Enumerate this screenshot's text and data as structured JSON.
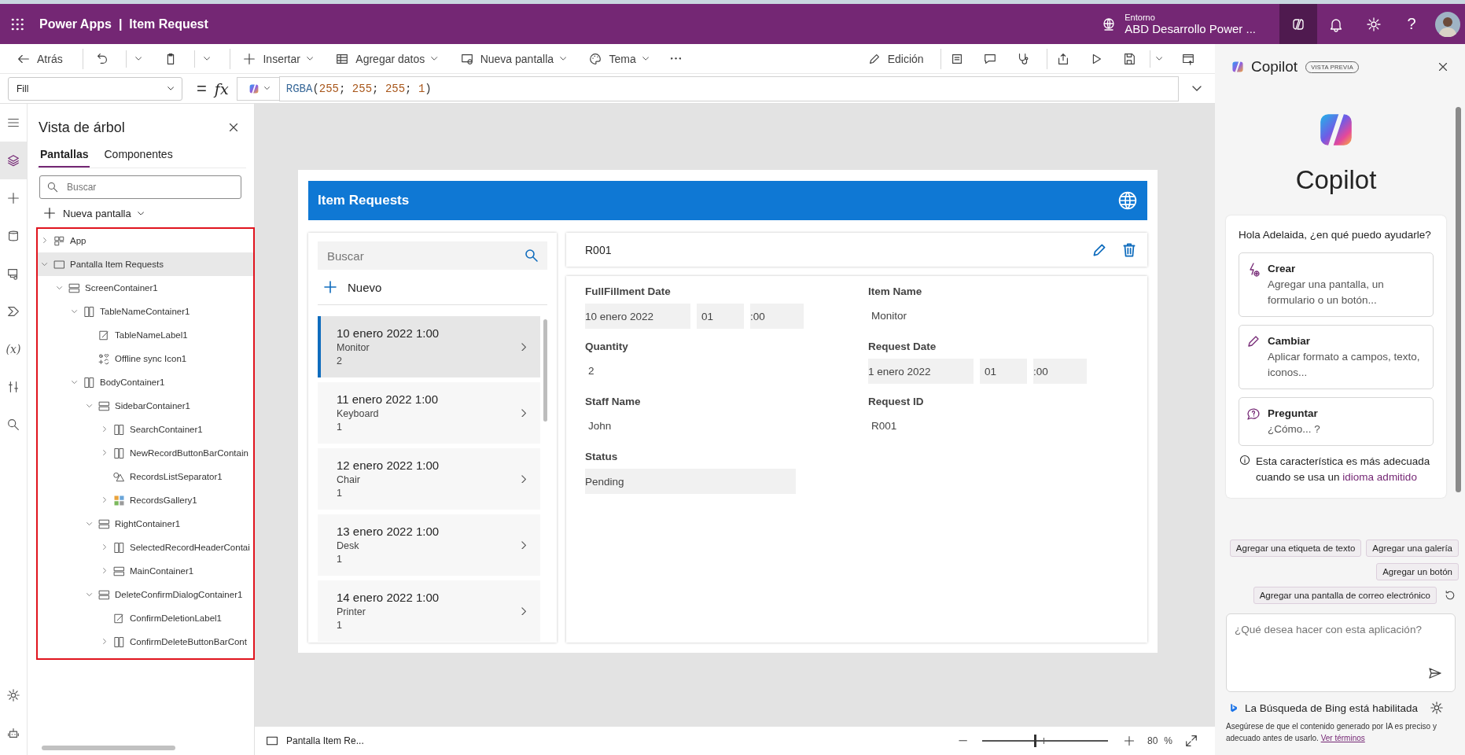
{
  "top_bar": {
    "product": "Power Apps",
    "divider": "|",
    "app_name": "Item Request",
    "environment_label": "Entorno",
    "environment_name": "ABD Desarrollo Power ...",
    "copilot_on": true,
    "help": "?"
  },
  "toolbar": {
    "back": "Atrás",
    "menus": [
      {
        "kind": "insert",
        "label": "Insertar"
      },
      {
        "kind": "data",
        "label": "Agregar datos"
      },
      {
        "kind": "screen",
        "label": "Nueva pantalla"
      },
      {
        "kind": "theme",
        "label": "Tema"
      }
    ],
    "edit": "Edición"
  },
  "formula_bar": {
    "property": "Fill",
    "equals": "=",
    "fx": "fx",
    "formula": [
      {
        "text": "RGBA",
        "kind": "function"
      },
      {
        "text": "(",
        "kind": "punct"
      },
      {
        "text": "255",
        "kind": "number"
      },
      {
        "text": "; ",
        "kind": "punct"
      },
      {
        "text": "255",
        "kind": "number"
      },
      {
        "text": "; ",
        "kind": "punct"
      },
      {
        "text": "255",
        "kind": "number"
      },
      {
        "text": "; ",
        "kind": "punct"
      },
      {
        "text": "1",
        "kind": "number"
      },
      {
        "text": ")",
        "kind": "punct"
      }
    ]
  },
  "rail": [
    {
      "kind": "menu",
      "selected": false
    },
    {
      "kind": "tree",
      "selected": true
    },
    {
      "kind": "insert",
      "selected": false
    },
    {
      "kind": "data",
      "selected": false
    },
    {
      "kind": "media",
      "selected": false
    },
    {
      "kind": "flow",
      "selected": false
    },
    {
      "kind": "variables",
      "glyph": "(x)",
      "selected": false
    },
    {
      "kind": "tools",
      "selected": false
    },
    {
      "kind": "search",
      "selected": false
    }
  ],
  "rail_bottom": [
    {
      "kind": "settings"
    },
    {
      "kind": "bot"
    }
  ],
  "tree_view": {
    "title": "Vista de árbol",
    "tabs": [
      {
        "label": "Pantallas",
        "selected": true
      },
      {
        "label": "Componentes",
        "selected": false
      }
    ],
    "search_placeholder": "Buscar",
    "new_screen": "Nueva pantalla",
    "items": [
      {
        "label": "App",
        "kind": "app",
        "expanded": false,
        "selected": false
      },
      {
        "label": "Pantalla Item Requests",
        "kind": "screen",
        "expanded": true,
        "selected": true,
        "children": [
          {
            "label": "ScreenContainer1",
            "kind": "rows",
            "expanded": true,
            "selected": false,
            "children": [
              {
                "label": "TableNameContainer1",
                "kind": "cols",
                "expanded": true,
                "selected": false,
                "children": [
                  {
                    "label": "TableNameLabel1",
                    "kind": "label",
                    "selected": false
                  },
                  {
                    "label": "Offline sync Icon1",
                    "kind": "icons",
                    "selected": false
                  }
                ]
              },
              {
                "label": "BodyContainer1",
                "kind": "cols",
                "expanded": true,
                "selected": false,
                "children": [
                  {
                    "label": "SidebarContainer1",
                    "kind": "rows",
                    "expanded": true,
                    "selected": false,
                    "children": [
                      {
                        "label": "SearchContainer1",
                        "kind": "cols",
                        "expanded": false,
                        "selected": false
                      },
                      {
                        "label": "NewRecordButtonBarContain",
                        "kind": "cols",
                        "expanded": false,
                        "selected": false
                      },
                      {
                        "label": "RecordsListSeparator1",
                        "kind": "shapes",
                        "selected": false
                      },
                      {
                        "label": "RecordsGallery1",
                        "kind": "gallery",
                        "expanded": false,
                        "selected": false
                      }
                    ]
                  },
                  {
                    "label": "RightContainer1",
                    "kind": "rows",
                    "expanded": true,
                    "selected": false,
                    "children": [
                      {
                        "label": "SelectedRecordHeaderContai",
                        "kind": "cols",
                        "expanded": false,
                        "selected": false
                      },
                      {
                        "label": "MainContainer1",
                        "kind": "rows",
                        "expanded": false,
                        "selected": false
                      }
                    ]
                  },
                  {
                    "label": "DeleteConfirmDialogContainer1",
                    "kind": "rows",
                    "expanded": true,
                    "selected": false,
                    "children": [
                      {
                        "label": "ConfirmDeletionLabel1",
                        "kind": "label",
                        "selected": false
                      },
                      {
                        "label": "ConfirmDeleteButtonBarCont",
                        "kind": "cols",
                        "expanded": false,
                        "selected": false
                      }
                    ]
                  }
                ]
              }
            ]
          }
        ]
      }
    ]
  },
  "app_preview": {
    "title": "Item Requests",
    "search_placeholder": "Buscar",
    "new_button": "Nuevo",
    "gallery": [
      {
        "date": "10 enero 2022 1:00",
        "item": "Monitor",
        "quantity": "2",
        "selected": true
      },
      {
        "date": "11 enero 2022 1:00",
        "item": "Keyboard",
        "quantity": "1",
        "selected": false
      },
      {
        "date": "12 enero 2022 1:00",
        "item": "Chair",
        "quantity": "1",
        "selected": false
      },
      {
        "date": "13 enero 2022 1:00",
        "item": "Desk",
        "quantity": "1",
        "selected": false
      },
      {
        "date": "14 enero 2022 1:00",
        "item": "Printer",
        "quantity": "1",
        "selected": false
      }
    ],
    "record_title": "R001",
    "fields": [
      {
        "label": "FullFillment Date",
        "kind": "datetime",
        "date": "10 enero 2022",
        "hour": "01",
        "minute": ":00"
      },
      {
        "label": "Item Name",
        "kind": "text",
        "value": "Monitor"
      },
      {
        "label": "Quantity",
        "kind": "text",
        "value": "2"
      },
      {
        "label": "Request Date",
        "kind": "datetime",
        "date": "1 enero 2022",
        "hour": "01",
        "minute": ":00"
      },
      {
        "label": "Staff Name",
        "kind": "text",
        "value": "John"
      },
      {
        "label": "Request ID",
        "kind": "text",
        "value": "R001"
      },
      {
        "label": "Status",
        "kind": "choice",
        "value": "Pending"
      }
    ]
  },
  "copilot": {
    "title": "Copilot",
    "badge": "VISTA PREVIA",
    "hero_title": "Copilot",
    "greeting": "Hola Adelaida, ¿en qué puedo ayudarle?",
    "options": [
      {
        "kind": "create",
        "title": "Crear",
        "description": "Agregar una pantalla, un formulario o un botón..."
      },
      {
        "kind": "change",
        "title": "Cambiar",
        "description": "Aplicar formato a campos, texto, iconos..."
      },
      {
        "kind": "ask",
        "title": "Preguntar",
        "description": "¿Cómo... ?"
      }
    ],
    "info_text": "Esta característica es más adecuada cuando se usa un",
    "info_link": "idioma admitido",
    "suggestions": [
      "Agregar una etiqueta de texto",
      "Agregar una galería",
      "Agregar un botón",
      "Agregar una pantalla de correo electrónico"
    ],
    "input_placeholder": "¿Qué desea hacer con esta aplicación?",
    "bing_text": "La Búsqueda de Bing está habilitada",
    "disclaimer": "Asegúrese de que el contenido generado por IA es preciso y adecuado antes de usarlo.",
    "disclaimer_link": "Ver términos"
  },
  "status_bar": {
    "screen_name": "Pantalla Item Re...",
    "zoom": {
      "level": 0.42
    },
    "zoom_value": "80",
    "zoom_unit": "%"
  }
}
